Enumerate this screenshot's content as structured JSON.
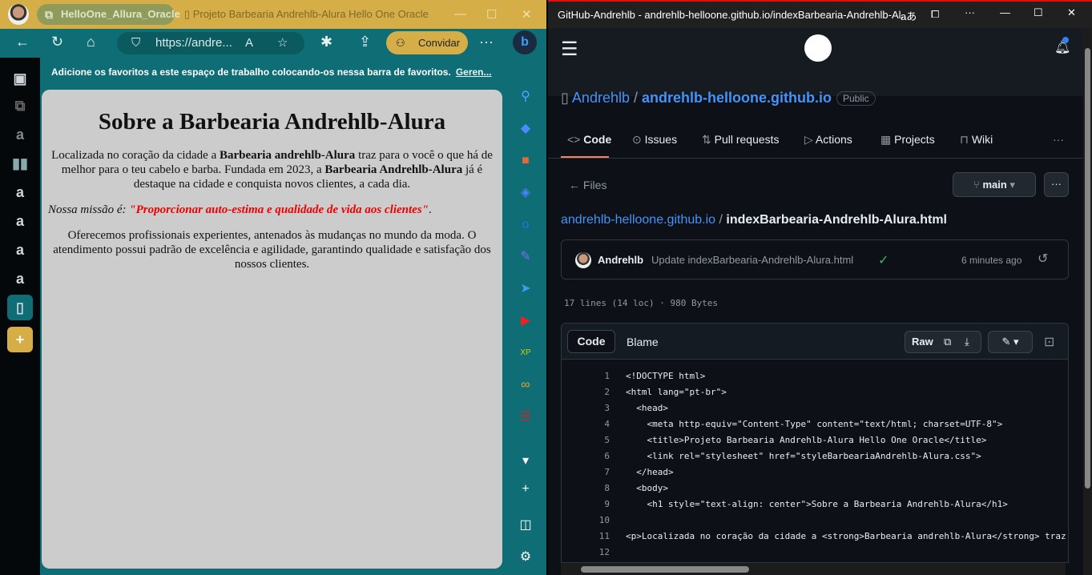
{
  "left_browser": {
    "workspace_tab": "HelloOne_Allura_Oracle",
    "page_tab": "Projeto Barbearia Andrehlb-Alura Hello One Oracle",
    "address": "https://andre...",
    "invite_label": "Convidar",
    "favorites_bar": {
      "message": "Adicione os favoritos a este espaço de trabalho colocando-os nessa barra de favoritos.",
      "manage_link": "Geren..."
    },
    "page": {
      "title": "Sobre a Barbearia Andrehlb-Alura",
      "p1_a": "Localizada no coração da cidade a ",
      "p1_b": "Barbearia andrehlb-Alura",
      "p1_c": " traz para o você o que há de melhor para o teu cabelo e barba. Fundada em 2023, a ",
      "p1_d": "Barbearia Andrehlb-Alura",
      "p1_e": " já é destaque na cidade e conquista novos clientes, a cada dia.",
      "mission_label": "Nossa missão é: ",
      "mission_text": "\"Proporcionar auto-estima e qualidade de vida aos clientes\"",
      "mission_end": ".",
      "p3": "Oferecemos profissionais experientes, antenados às mudanças no mundo da moda. O atendimento possui padrão de excelência e agilidade, garantindo qualidade e satisfação dos nossos clientes."
    },
    "colors": {
      "title_bar": "#d6ae48",
      "toolbar": "#0e6d75",
      "content_bg": "#cccccc",
      "mission": "#ee0000"
    }
  },
  "right_browser": {
    "window_title": "GitHub-Andrehlb - andrehlb-helloone.github.io/indexBarbearia-Andrehlb-Al...",
    "repo": {
      "owner": "Andrehlb",
      "name": "andrehlb-helloone.github.io",
      "visibility": "Public"
    },
    "tabs": [
      "Code",
      "Issues",
      "Pull requests",
      "Actions",
      "Projects",
      "Wiki"
    ],
    "files_label": "Files",
    "branch": "main",
    "breadcrumb": {
      "repo": "andrehlb-helloone.github.io",
      "file": "indexBarbearia-Andrehlb-Alura.html"
    },
    "commit": {
      "author": "Andrehlb",
      "message": "Update indexBarbearia-Andrehlb-Alura.html",
      "time": "6 minutes ago"
    },
    "file_info": "17 lines (14 loc) · 980 Bytes",
    "code_tabs": [
      "Code",
      "Blame"
    ],
    "raw_label": "Raw",
    "lines": [
      "<!DOCTYPE html>",
      "<html lang=\"pt-br\">",
      "  <head>",
      "    <meta http-equiv=\"Content-Type\" content=\"text/html; charset=UTF-8\">",
      "    <title>Projeto Barbearia Andrehlb-Alura Hello One Oracle</title>",
      "    <link rel=\"stylesheet\" href=\"styleBarbeariaAndrehlb-Alura.css\">",
      "  </head>",
      "  <body>",
      "    <h1 style=\"text-align: center\">Sobre a Barbearia Andrehlb-Alura</h1>",
      "",
      "<p>Localizada no coração da cidade a <strong>Barbearia andrehlb-Alura</strong> traz",
      ""
    ]
  }
}
